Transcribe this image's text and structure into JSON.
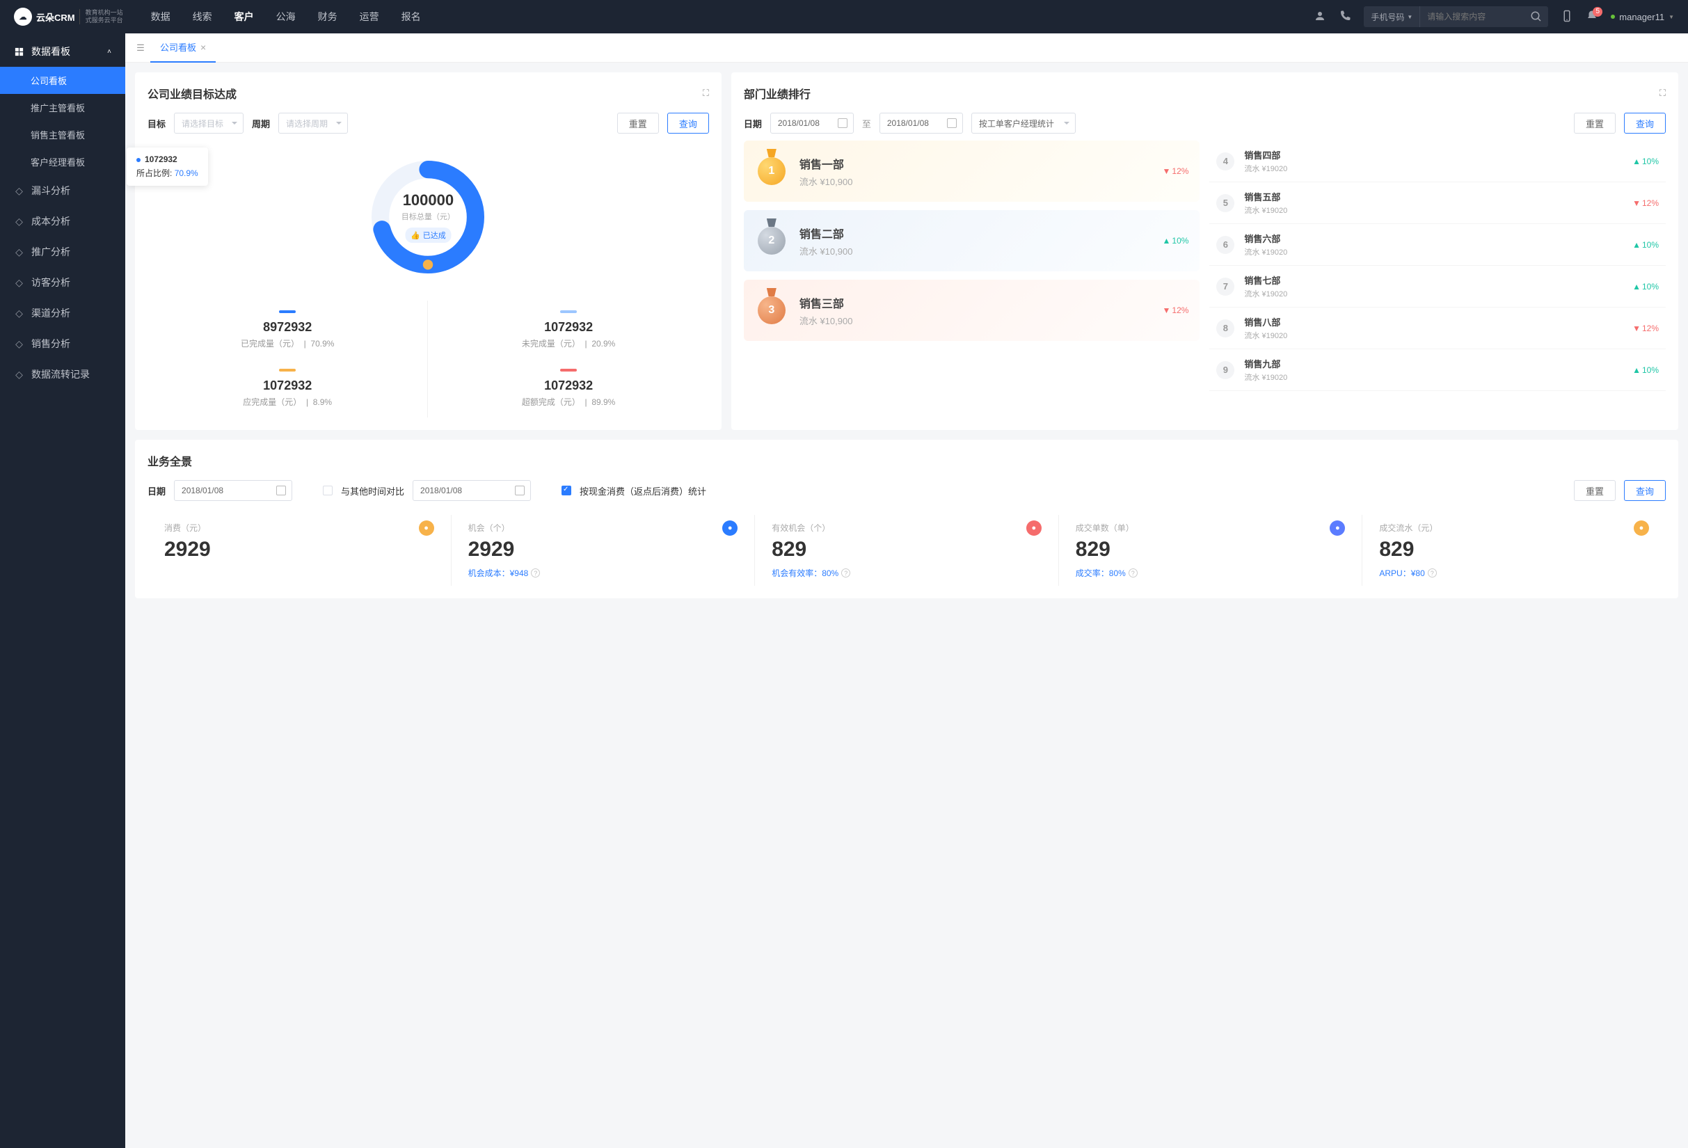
{
  "brand": {
    "name": "云朵CRM",
    "tagline1": "教育机构一站",
    "tagline2": "式服务云平台"
  },
  "nav": [
    "数据",
    "线索",
    "客户",
    "公海",
    "财务",
    "运营",
    "报名"
  ],
  "nav_active": 2,
  "search": {
    "type": "手机号码",
    "placeholder": "请输入搜索内容"
  },
  "notif_count": "5",
  "user": "manager11",
  "sidebar": {
    "group": "数据看板",
    "subs": [
      "公司看板",
      "推广主管看板",
      "销售主管看板",
      "客户经理看板"
    ],
    "sub_active": 0,
    "items": [
      "漏斗分析",
      "成本分析",
      "推广分析",
      "访客分析",
      "渠道分析",
      "销售分析",
      "数据流转记录"
    ]
  },
  "tab": {
    "label": "公司看板"
  },
  "goal": {
    "title": "公司业绩目标达成",
    "lbl_target": "目标",
    "ph_target": "请选择目标",
    "lbl_period": "周期",
    "ph_period": "请选择周期",
    "btn_reset": "重置",
    "btn_query": "查询",
    "tooltip_val": "1072932",
    "tooltip_lbl": "所占比例:",
    "tooltip_pct": "70.9%",
    "center_val": "100000",
    "center_lbl": "目标总量（元）",
    "center_badge": "已达成",
    "stats": [
      {
        "color": "#2b7cff",
        "val": "8972932",
        "lbl": "已完成量（元）",
        "pct": "70.9%"
      },
      {
        "color": "#9cc6ff",
        "val": "1072932",
        "lbl": "未完成量（元）",
        "pct": "20.9%"
      },
      {
        "color": "#f7b24a",
        "val": "1072932",
        "lbl": "应完成量（元）",
        "pct": "8.9%"
      },
      {
        "color": "#f56c6c",
        "val": "1072932",
        "lbl": "超额完成（元）",
        "pct": "89.9%"
      }
    ]
  },
  "rank": {
    "title": "部门业绩排行",
    "lbl_date": "日期",
    "date1": "2018/01/08",
    "date_to": "至",
    "date2": "2018/01/08",
    "stat_by": "按工单客户经理统计",
    "btn_reset": "重置",
    "btn_query": "查询",
    "top3": [
      {
        "rank": "1",
        "name": "销售一部",
        "sub": "流水 ¥10,900",
        "delta": "12%",
        "dir": "down"
      },
      {
        "rank": "2",
        "name": "销售二部",
        "sub": "流水 ¥10,900",
        "delta": "10%",
        "dir": "up"
      },
      {
        "rank": "3",
        "name": "销售三部",
        "sub": "流水 ¥10,900",
        "delta": "12%",
        "dir": "down"
      }
    ],
    "rest": [
      {
        "rank": "4",
        "name": "销售四部",
        "sub": "流水 ¥19020",
        "delta": "10%",
        "dir": "up"
      },
      {
        "rank": "5",
        "name": "销售五部",
        "sub": "流水 ¥19020",
        "delta": "12%",
        "dir": "down"
      },
      {
        "rank": "6",
        "name": "销售六部",
        "sub": "流水 ¥19020",
        "delta": "10%",
        "dir": "up"
      },
      {
        "rank": "7",
        "name": "销售七部",
        "sub": "流水 ¥19020",
        "delta": "10%",
        "dir": "up"
      },
      {
        "rank": "8",
        "name": "销售八部",
        "sub": "流水 ¥19020",
        "delta": "12%",
        "dir": "down"
      },
      {
        "rank": "9",
        "name": "销售九部",
        "sub": "流水 ¥19020",
        "delta": "10%",
        "dir": "up"
      }
    ]
  },
  "overview": {
    "title": "业务全景",
    "lbl_date": "日期",
    "date1": "2018/01/08",
    "compare_lbl": "与其他时间对比",
    "date2": "2018/01/08",
    "checkbox_lbl": "按现金消费（返点后消费）统计",
    "btn_reset": "重置",
    "btn_query": "查询",
    "kpis": [
      {
        "lbl": "消费（元）",
        "val": "2929",
        "sub": "",
        "icon_bg": "#f7b24a",
        "icon": "money-bag-icon"
      },
      {
        "lbl": "机会（个）",
        "val": "2929",
        "sub": "机会成本：¥948",
        "icon_bg": "#2b7cff",
        "icon": "send-icon"
      },
      {
        "lbl": "有效机会（个）",
        "val": "829",
        "sub": "机会有效率：80%",
        "icon_bg": "#f56c6c",
        "icon": "shield-icon"
      },
      {
        "lbl": "成交单数（单）",
        "val": "829",
        "sub": "成交率：80%",
        "icon_bg": "#5b7cff",
        "icon": "doc-icon"
      },
      {
        "lbl": "成交流水（元）",
        "val": "829",
        "sub": "ARPU：¥80",
        "icon_bg": "#f7b24a",
        "icon": "card-icon"
      }
    ]
  },
  "chart_data": {
    "type": "pie",
    "title": "目标总量（元）",
    "total": 100000,
    "series": [
      {
        "name": "已完成量（元）",
        "value": 8972932,
        "pct": 70.9,
        "color": "#2b7cff"
      },
      {
        "name": "未完成量（元）",
        "value": 1072932,
        "pct": 20.9,
        "color": "#9cc6ff"
      },
      {
        "name": "应完成量（元）",
        "value": 1072932,
        "pct": 8.9,
        "color": "#f7b24a"
      },
      {
        "name": "超额完成（元）",
        "value": 1072932,
        "pct": 89.9,
        "color": "#f56c6c"
      }
    ]
  }
}
